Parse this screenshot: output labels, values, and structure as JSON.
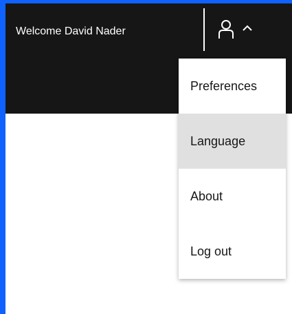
{
  "header": {
    "welcome_text": "Welcome David Nader",
    "user_icon": "user-icon",
    "chevron_icon": "chevron-up-icon"
  },
  "menu": {
    "items": [
      {
        "label": "Preferences"
      },
      {
        "label": "Language",
        "active": true
      },
      {
        "label": "About"
      },
      {
        "label": "Log out"
      }
    ]
  },
  "colors": {
    "frame_border": "#0f62fe",
    "header_bg": "#161616",
    "menu_active_bg": "#e0e0e0",
    "text_dark": "#161616",
    "text_light": "#ffffff"
  }
}
